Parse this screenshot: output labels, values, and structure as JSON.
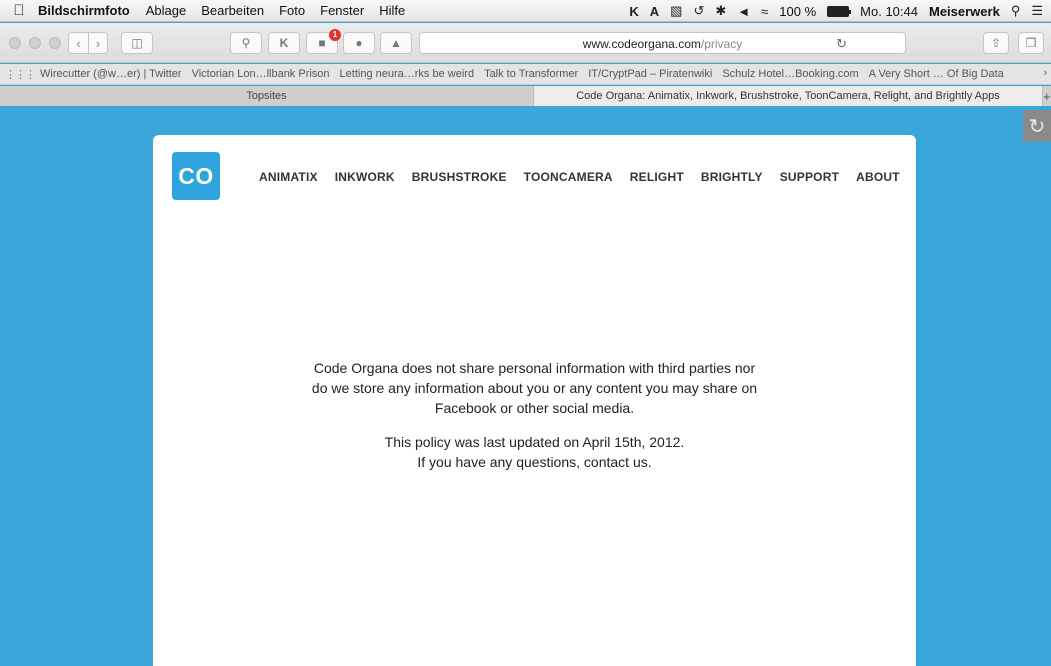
{
  "menubar": {
    "app": "Bildschirmfoto",
    "items": [
      "Ablage",
      "Bearbeiten",
      "Foto",
      "Fenster",
      "Hilfe"
    ],
    "battery": "100 %",
    "clock": "Mo. 10:44",
    "user": "Meiserwerk"
  },
  "toolbar": {
    "url_host": "www.codeorgana.com",
    "url_path": "/privacy",
    "badge_count": "1"
  },
  "bookmarks": [
    "Wirecutter (@w…er) | Twitter",
    "Victorian Lon…llbank Prison",
    "Letting neura…rks be weird",
    "Talk to Transformer",
    "IT/CryptPad – Piratenwiki",
    "Schulz Hotel…Booking.com",
    "A Very Short … Of Big Data"
  ],
  "tabs": {
    "inactive": "Topsites",
    "active": "Code Organa: Animatix, Inkwork, Brushstroke, ToonCamera, Relight, and Brightly Apps"
  },
  "site": {
    "logo": "CO",
    "nav": [
      "ANIMATIX",
      "INKWORK",
      "BRUSHSTROKE",
      "TOONCAMERA",
      "RELIGHT",
      "BRIGHTLY",
      "SUPPORT",
      "ABOUT"
    ],
    "policy_line1": "Code Organa does not share personal information with third parties nor",
    "policy_line2": "do we store any information about you or any content you may share on",
    "policy_line3": "Facebook or other social media.",
    "updated_line1": "This policy was last updated on April 15th, 2012.",
    "updated_line2": "If you have any questions, contact us."
  },
  "colors": {
    "page_background": "#3aa6d9",
    "logo_background": "#2ea3dd"
  }
}
